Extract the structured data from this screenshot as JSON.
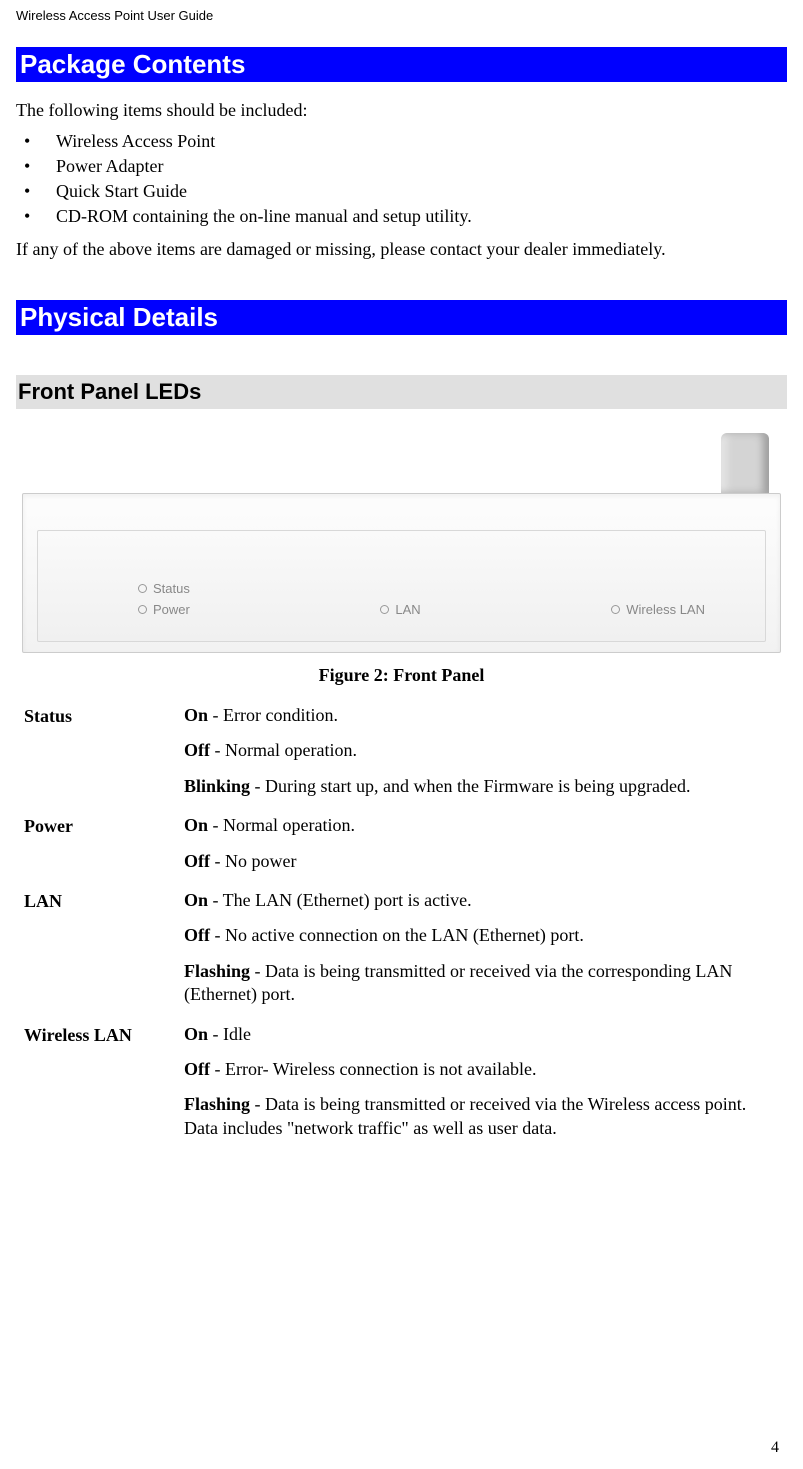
{
  "header": {
    "title": "Wireless Access Point User Guide"
  },
  "sections": {
    "package": {
      "title": "Package Contents",
      "intro": "The following items should be included:",
      "items": [
        "Wireless Access Point",
        "Power Adapter",
        "Quick Start Guide",
        "CD-ROM containing the on-line manual and setup utility."
      ],
      "outro": "If any of the above items are damaged or missing, please contact your dealer immediately."
    },
    "physical": {
      "title": "Physical Details",
      "front_panel": {
        "title": "Front Panel LEDs",
        "panel_labels": {
          "status": "Status",
          "power": "Power",
          "lan": "LAN",
          "wlan": "Wireless LAN"
        },
        "caption": "Figure 2: Front Panel",
        "rows": [
          {
            "label": "Status",
            "lines": [
              {
                "b": "On",
                "t": " - Error condition."
              },
              {
                "b": "Off",
                "t": " - Normal operation."
              },
              {
                "b": "Blinking",
                "t": " - During start up, and when the Firmware is being  upgraded."
              }
            ]
          },
          {
            "label": "Power",
            "lines": [
              {
                "b": "On",
                "t": " - Normal operation."
              },
              {
                "b": "Off",
                "t": "  - No power"
              }
            ]
          },
          {
            "label": "LAN",
            "lines": [
              {
                "b": "On",
                "t": " - The LAN (Ethernet) port is active."
              },
              {
                "b": "Off",
                "t": " - No active connection on the LAN (Ethernet) port."
              },
              {
                "b": "Flashing",
                "t": " - Data is being transmitted or received via the corresponding LAN (Ethernet) port."
              }
            ]
          },
          {
            "label": "Wireless LAN",
            "lines": [
              {
                "b": "On",
                "t": " - Idle"
              },
              {
                "b": "Off",
                "t": " - Error- Wireless connection is not available."
              },
              {
                "b": "Flashing",
                "t": " - Data is being transmitted or received via the Wireless access point. Data includes \"network traffic\" as well as user data."
              }
            ]
          }
        ]
      }
    }
  },
  "page_number": "4"
}
